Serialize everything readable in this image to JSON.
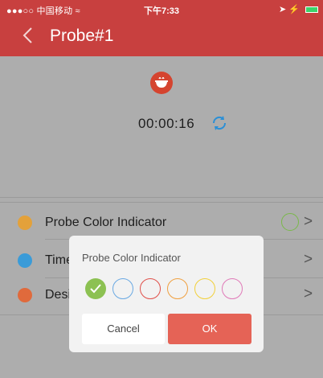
{
  "status_bar": {
    "carrier": "●●●○○ 中国移动 ≈",
    "time": "下午7:33",
    "right_icons": "➤ ⚡"
  },
  "nav": {
    "title": "Probe#1"
  },
  "top": {
    "timer": "00:00:16"
  },
  "list": {
    "items": [
      {
        "label": "Probe Color Indicator",
        "icon_color": "#e3a13a"
      },
      {
        "label": "Time",
        "icon_color": "#3a9bd8"
      },
      {
        "label": "Desi",
        "icon_color": "#e06a3c"
      }
    ],
    "chevron": ">"
  },
  "dialog": {
    "title": "Probe Color Indicator",
    "swatches": [
      {
        "color": "#8cc152",
        "selected": true
      },
      {
        "color": "#6aa9e3",
        "selected": false
      },
      {
        "color": "#e0504a",
        "selected": false
      },
      {
        "color": "#f0a040",
        "selected": false
      },
      {
        "color": "#f2d03a",
        "selected": false
      },
      {
        "color": "#e07ab8",
        "selected": false
      }
    ],
    "cancel_label": "Cancel",
    "ok_label": "OK"
  },
  "colors": {
    "header": "#c8403f",
    "ok_button": "#e56356"
  }
}
